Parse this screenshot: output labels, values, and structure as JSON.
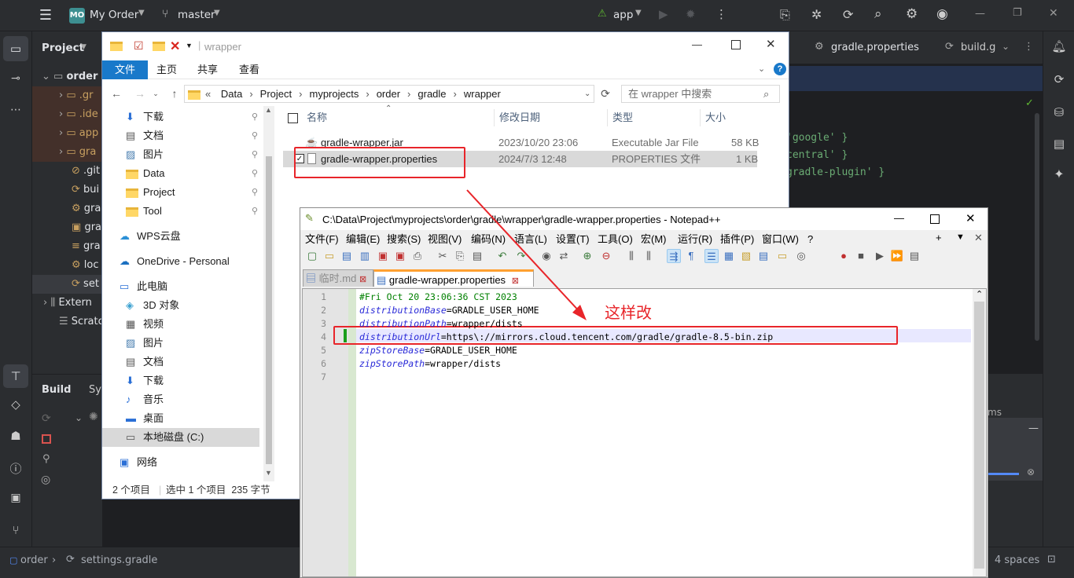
{
  "ide": {
    "project_badge": "MO",
    "project_name": "My Order",
    "branch": "master",
    "run_config": "app",
    "project_panel_title": "Project",
    "tree_root": "order",
    "tree_items": [
      ".gr",
      ".ide",
      "app",
      "gra",
      ".git",
      "bui",
      "gra",
      "gra",
      "gra",
      "loc",
      "set"
    ],
    "tree_external": "Extern",
    "tree_scratches": "Scratc",
    "build_tab": "Build",
    "sync_tab": "Syn",
    "editor_tab_gradle_properties": "gradle.properties",
    "editor_tab_build": "build.g",
    "code_lines": [
      "google' }",
      "central' }",
      "gradle-plugin' }"
    ],
    "lower_panel_fragment": "ms",
    "status_breadcrumb_root": "order",
    "status_breadcrumb_file": "settings.gradle",
    "status_indent": "4 spaces"
  },
  "explorer": {
    "title": "wrapper",
    "ribbon_tabs": [
      "文件",
      "主页",
      "共享",
      "查看"
    ],
    "path": [
      "Data",
      "Project",
      "myprojects",
      "order",
      "gradle",
      "wrapper"
    ],
    "search_placeholder": "在 wrapper 中搜索",
    "nav_items": [
      {
        "label": "下载",
        "icon": "download-icon"
      },
      {
        "label": "文档",
        "icon": "document-icon"
      },
      {
        "label": "图片",
        "icon": "picture-icon"
      },
      {
        "label": "Data",
        "icon": "folder-icon"
      },
      {
        "label": "Project",
        "icon": "folder-icon"
      },
      {
        "label": "Tool",
        "icon": "folder-icon"
      },
      {
        "label": "WPS云盘",
        "icon": "cloud-icon"
      },
      {
        "label": "OneDrive - Personal",
        "icon": "onedrive-icon"
      },
      {
        "label": "此电脑",
        "icon": "computer-icon"
      },
      {
        "label": "3D 对象",
        "icon": "cube-icon"
      },
      {
        "label": "视频",
        "icon": "video-icon"
      },
      {
        "label": "图片",
        "icon": "picture-icon"
      },
      {
        "label": "文档",
        "icon": "document-icon"
      },
      {
        "label": "下载",
        "icon": "download-icon"
      },
      {
        "label": "音乐",
        "icon": "music-icon"
      },
      {
        "label": "桌面",
        "icon": "desktop-icon"
      },
      {
        "label": "本地磁盘 (C:)",
        "icon": "drive-icon"
      },
      {
        "label": "网络",
        "icon": "network-icon"
      }
    ],
    "columns": [
      "名称",
      "修改日期",
      "类型",
      "大小"
    ],
    "files": [
      {
        "name": "gradle-wrapper.jar",
        "date": "2023/10/20 23:06",
        "type": "Executable Jar File",
        "size": "58 KB"
      },
      {
        "name": "gradle-wrapper.properties",
        "date": "2024/7/3 12:48",
        "type": "PROPERTIES 文件",
        "size": "1 KB"
      }
    ],
    "status_count": "2 个项目",
    "status_selection": "选中 1 个项目  235 字节"
  },
  "notepad": {
    "title": "C:\\Data\\Project\\myprojects\\order\\gradle\\wrapper\\gradle-wrapper.properties - Notepad++",
    "menus": [
      "文件(F)",
      "编辑(E)",
      "搜索(S)",
      "视图(V)",
      "编码(N)",
      "语言(L)",
      "设置(T)",
      "工具(O)",
      "宏(M)",
      "运行(R)",
      "插件(P)",
      "窗口(W)",
      "?"
    ],
    "tabs": [
      "临时.md",
      "gradle-wrapper.properties"
    ],
    "line_numbers": [
      "1",
      "2",
      "3",
      "4",
      "5",
      "6",
      "7"
    ],
    "lines": [
      {
        "comment": "#Fri Oct 20 23:06:36 CST 2023"
      },
      {
        "key": "distributionBase",
        "value": "GRADLE_USER_HOME"
      },
      {
        "key": "distributionPath",
        "value": "wrapper/dists"
      },
      {
        "key": "distributionUrl",
        "value": "https\\://mirrors.cloud.tencent.com/gradle/gradle-8.5-bin.zip"
      },
      {
        "key": "zipStoreBase",
        "value": "GRADLE_USER_HOME"
      },
      {
        "key": "zipStorePath",
        "value": "wrapper/dists"
      }
    ]
  },
  "annotation": {
    "text": "这样改",
    "color": "#e8252a"
  }
}
